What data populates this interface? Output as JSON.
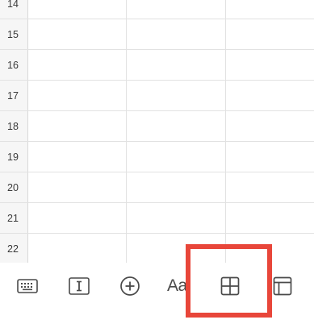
{
  "sheet": {
    "rows": [
      {
        "number": "14"
      },
      {
        "number": "15"
      },
      {
        "number": "16"
      },
      {
        "number": "17"
      },
      {
        "number": "18"
      },
      {
        "number": "19"
      },
      {
        "number": "20"
      },
      {
        "number": "21"
      },
      {
        "number": "22"
      }
    ]
  },
  "toolbar": {
    "items": [
      {
        "icon": "keyboard-icon"
      },
      {
        "icon": "text-cursor-icon"
      },
      {
        "icon": "add-circle-icon"
      },
      {
        "icon": "text-format-icon",
        "label": "Aa"
      },
      {
        "icon": "table-grid-icon"
      },
      {
        "icon": "table-layout-icon"
      }
    ]
  },
  "annotation": {
    "highlight_color": "#e8463a",
    "highlight_target": "table-grid-icon"
  },
  "colors": {
    "grid_line": "#e2e2e2",
    "row_header_bg": "#f6f6f6",
    "icon": "#4a4a4a"
  }
}
